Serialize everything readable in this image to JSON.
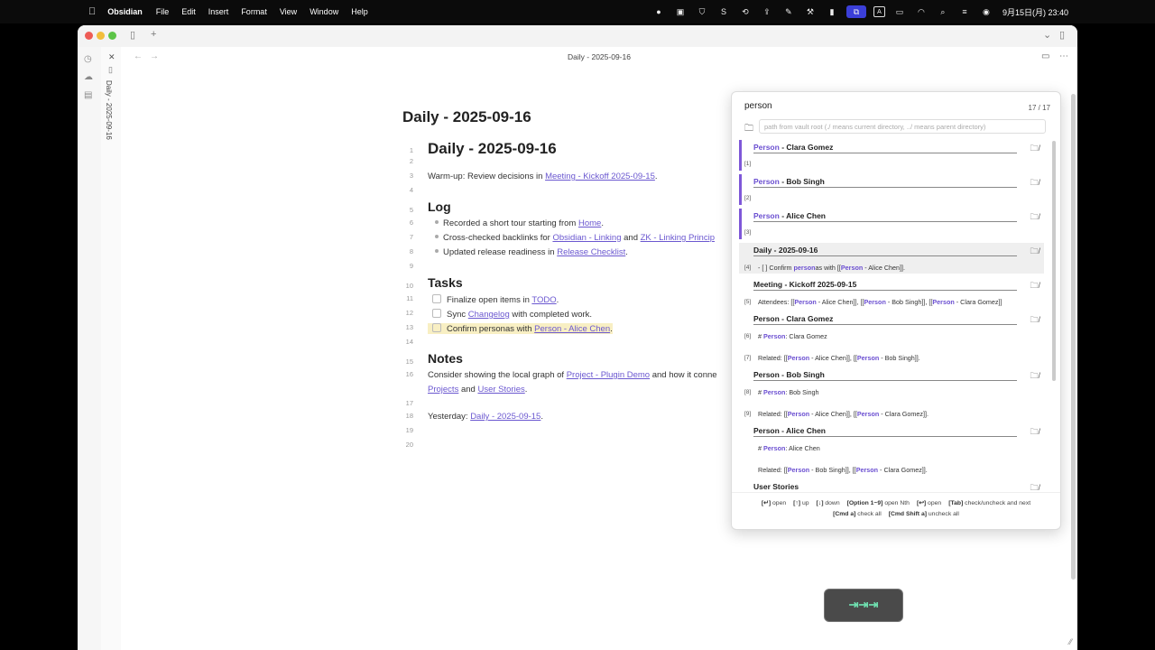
{
  "menubar": {
    "apple": "",
    "app": "Obsidian",
    "menus": [
      "File",
      "Edit",
      "Insert",
      "Format",
      "View",
      "Window",
      "Help"
    ],
    "clock": "9月15日(月) 23:40",
    "status_icons": [
      "record-icon",
      "display-icon",
      "shield-icon",
      "s-icon",
      "sync-icon",
      "share-icon",
      "pen-icon",
      "tool-icon",
      "phone-icon",
      "screen-mirror-icon",
      "input-a-icon",
      "battery-icon",
      "wifi-icon",
      "search-icon",
      "control-center-icon",
      "siri-icon"
    ]
  },
  "tab": {
    "vertical_label": "Daily - 2025-09-16"
  },
  "navbar": {
    "title": "Daily - 2025-09-16"
  },
  "note": {
    "inline_title": "Daily - 2025-09-16",
    "lines": [
      {
        "n": "1",
        "text": "Daily - 2025-09-16"
      },
      {
        "n": "2"
      },
      {
        "n": "3",
        "pre": "Warm-up: Review decisions in ",
        "link": "Meeting - Kickoff 2025-09-15",
        "post": "."
      },
      {
        "n": "4"
      },
      {
        "n": "5",
        "text": "Log"
      },
      {
        "n": "6",
        "pre": "Recorded a short tour starting from ",
        "link": "Home",
        "post": "."
      },
      {
        "n": "7",
        "pre": "Cross-checked backlinks for ",
        "link": "Obsidian - Linking",
        "mid": " and ",
        "link2": "ZK - Linking Princip"
      },
      {
        "n": "8",
        "pre": "Updated release readiness in ",
        "link": "Release Checklist",
        "post": "."
      },
      {
        "n": "9"
      },
      {
        "n": "10",
        "text": "Tasks"
      },
      {
        "n": "11",
        "pre": "Finalize open items in ",
        "link": "TODO",
        "post": "."
      },
      {
        "n": "12",
        "pre": "Sync ",
        "link": "Changelog",
        "post": " with completed work."
      },
      {
        "n": "13",
        "pre": "Confirm personas with ",
        "link": "Person - Alice Chen",
        "post": "."
      },
      {
        "n": "14"
      },
      {
        "n": "15",
        "text": "Notes"
      },
      {
        "n": "16",
        "pre": "Consider showing the local graph of ",
        "link": "Project - Plugin Demo",
        "post": " and how it conne"
      },
      {
        "n": "",
        "link": "Projects",
        "mid": " and ",
        "link2": "User Stories",
        "post": "."
      },
      {
        "n": "17"
      },
      {
        "n": "18",
        "pre": "Yesterday: ",
        "link": "Daily - 2025-09-15",
        "post": "."
      },
      {
        "n": "19"
      },
      {
        "n": "20"
      }
    ]
  },
  "switcher": {
    "query": "person",
    "count": "17 / 17",
    "path_placeholder": "path from vault root (./ means current directory, ../ means parent directory)",
    "results": [
      {
        "title_match": "Person",
        "title_rest": " - Clara Gomez",
        "snips": [
          {
            "idx": "[1]"
          }
        ]
      },
      {
        "title_match": "Person",
        "title_rest": " - Bob Singh",
        "snips": [
          {
            "idx": "[2]"
          }
        ]
      },
      {
        "title_match": "Person",
        "title_rest": " - Alice Chen",
        "snips": [
          {
            "idx": "[3]"
          }
        ]
      },
      {
        "title": "Daily - 2025-09-16",
        "snips": [
          {
            "idx": "[4]",
            "parts": [
              "- [ ] Confirm ",
              "*person",
              "as with [[",
              "*Person",
              " - Alice Chen]]."
            ]
          }
        ]
      },
      {
        "title": "Meeting - Kickoff 2025-09-15",
        "snips": [
          {
            "idx": "[5]",
            "parts": [
              "Attendees: [[",
              "*Person",
              " - Alice Chen]], [[",
              "*Person",
              " - Bob Singh]], [[",
              "*Person",
              " - Clara Gomez]]"
            ]
          }
        ]
      },
      {
        "title": "Person - Clara Gomez",
        "snips": [
          {
            "idx": "[6]",
            "parts": [
              "# ",
              "*Person",
              ": Clara Gomez"
            ]
          },
          {
            "idx": "[7]",
            "parts": [
              "Related: [[",
              "*Person",
              " - Alice Chen]], [[",
              "*Person",
              " - Bob Singh]]."
            ]
          }
        ]
      },
      {
        "title": "Person - Bob Singh",
        "snips": [
          {
            "idx": "[8]",
            "parts": [
              "# ",
              "*Person",
              ": Bob Singh"
            ]
          },
          {
            "idx": "[9]",
            "parts": [
              "Related: [[",
              "*Person",
              " - Alice Chen]], [[",
              "*Person",
              " - Clara Gomez]]."
            ]
          }
        ]
      },
      {
        "title": "Person - Alice Chen",
        "snips": [
          {
            "idx": "",
            "parts": [
              "# ",
              "*Person",
              ": Alice Chen"
            ]
          },
          {
            "idx": "",
            "parts": [
              "Related: [[",
              "*Person",
              " - Bob Singh]], [[",
              "*Person",
              " - Clara Gomez]]."
            ]
          }
        ]
      },
      {
        "title": "User Stories",
        "snips": []
      }
    ],
    "footer_row1": [
      {
        "key": "[↵]",
        "label": "open"
      },
      {
        "key": "[↑]",
        "label": "up"
      },
      {
        "key": "[↓]",
        "label": "down"
      },
      {
        "key": "[Option 1~9]",
        "label": "open Nth"
      },
      {
        "key": "[↩]",
        "label": "open"
      },
      {
        "key": "[Tab]",
        "label": "check/uncheck and next"
      }
    ],
    "footer_row2": [
      {
        "key": "[Cmd a]",
        "label": "check all"
      },
      {
        "key": "[Cmd Shift a]",
        "label": "uncheck all"
      }
    ]
  },
  "tab_hud": "⇥⇥⇥",
  "colors": {
    "accent": "#6b58d0",
    "highlight": "#f8efc3",
    "selection_bar": "#7e57d8"
  }
}
